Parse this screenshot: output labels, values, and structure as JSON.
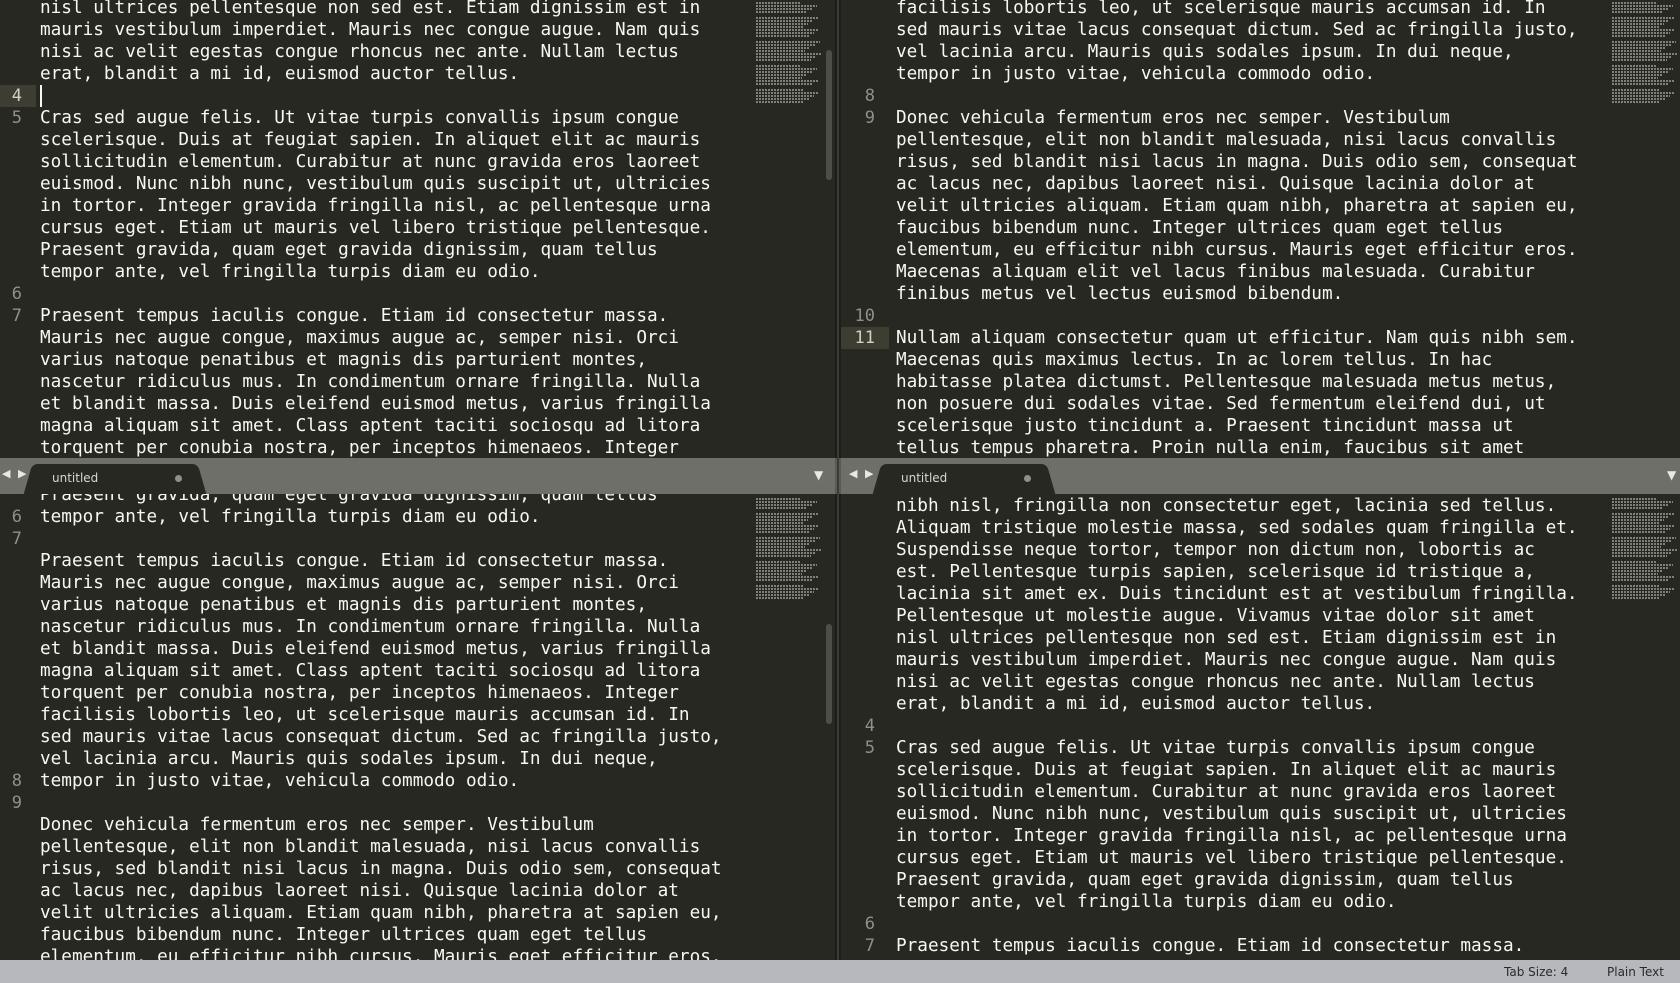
{
  "tabs": [
    {
      "label": "untitled"
    },
    {
      "label": "untitled"
    }
  ],
  "status": {
    "tab_size": "Tab Size: 4",
    "syntax": "Plain Text"
  },
  "panes": [
    {
      "id": "top-left",
      "gutter": [
        {
          "row": 4,
          "n": "4",
          "current": true
        },
        {
          "row": 5,
          "n": "5"
        },
        {
          "row": 13,
          "n": "6"
        },
        {
          "row": 14,
          "n": "7"
        }
      ],
      "lines": [
        "nisl ultrices pellentesque non sed est. Etiam dignissim est in",
        "mauris vestibulum imperdiet. Mauris nec congue augue. Nam quis",
        "nisi ac velit egestas congue rhoncus nec ante. Nullam lectus",
        "erat, blandit a mi id, euismod auctor tellus.",
        "",
        "Cras sed augue felis. Ut vitae turpis convallis ipsum congue",
        "scelerisque. Duis at feugiat sapien. In aliquet elit ac mauris",
        "sollicitudin elementum. Curabitur at nunc gravida eros laoreet",
        "euismod. Nunc nibh nunc, vestibulum quis suscipit ut, ultricies",
        "in tortor. Integer gravida fringilla nisl, ac pellentesque urna",
        "cursus eget. Etiam ut mauris vel libero tristique pellentesque.",
        "Praesent gravida, quam eget gravida dignissim, quam tellus",
        "tempor ante, vel fringilla turpis diam eu odio.",
        "",
        "Praesent tempus iaculis congue. Etiam id consectetur massa.",
        "Mauris nec augue congue, maximus augue ac, semper nisi. Orci",
        "varius natoque penatibus et magnis dis parturient montes,",
        "nascetur ridiculus mus. In condimentum ornare fringilla. Nulla",
        "et blandit massa. Duis eleifend euismod metus, varius fringilla",
        "magna aliquam sit amet. Class aptent taciti sociosqu ad litora",
        "torquent per conubia nostra, per inceptos himenaeos. Integer"
      ]
    },
    {
      "id": "top-right",
      "gutter": [
        {
          "row": 4,
          "n": "8"
        },
        {
          "row": 5,
          "n": "9"
        },
        {
          "row": 14,
          "n": "10"
        },
        {
          "row": 15,
          "n": "11",
          "current": true
        }
      ],
      "lines": [
        "facilisis lobortis leo, ut scelerisque mauris accumsan id. In",
        "sed mauris vitae lacus consequat dictum. Sed ac fringilla justo,",
        "vel lacinia arcu. Mauris quis sodales ipsum. In dui neque,",
        "tempor in justo vitae, vehicula commodo odio.",
        "",
        "Donec vehicula fermentum eros nec semper. Vestibulum",
        "pellentesque, elit non blandit malesuada, nisi lacus convallis",
        "risus, sed blandit nisi lacus in magna. Duis odio sem, consequat",
        "ac lacus nec, dapibus laoreet nisi. Quisque lacinia dolor at",
        "velit ultricies aliquam. Etiam quam nibh, pharetra at sapien eu,",
        "faucibus bibendum nunc. Integer ultrices quam eget tellus",
        "elementum, eu efficitur nibh cursus. Mauris eget efficitur eros.",
        "Maecenas aliquam elit vel lacus finibus malesuada. Curabitur",
        "finibus metus vel lectus euismod bibendum.",
        "",
        "Nullam aliquam consectetur quam ut efficitur. Nam quis nibh sem.",
        "Maecenas quis maximus lectus. In ac lorem tellus. In hac",
        "habitasse platea dictumst. Pellentesque malesuada metus metus,",
        "non posuere dui sodales vitae. Sed fermentum eleifend dui, ut",
        "scelerisque justo tincidunt a. Praesent tincidunt massa ut",
        "tellus tempus pharetra. Proin nulla enim, faucibus sit amet"
      ]
    },
    {
      "id": "bottom-left",
      "gutter": [
        {
          "row": 1,
          "n": "6"
        },
        {
          "row": 2,
          "n": "7"
        },
        {
          "row": 13,
          "n": "8"
        },
        {
          "row": 14,
          "n": "9"
        }
      ],
      "lines": [
        "Praesent gravida, quam eget gravida dignissim, quam tellus",
        "tempor ante, vel fringilla turpis diam eu odio.",
        "",
        "Praesent tempus iaculis congue. Etiam id consectetur massa.",
        "Mauris nec augue congue, maximus augue ac, semper nisi. Orci",
        "varius natoque penatibus et magnis dis parturient montes,",
        "nascetur ridiculus mus. In condimentum ornare fringilla. Nulla",
        "et blandit massa. Duis eleifend euismod metus, varius fringilla",
        "magna aliquam sit amet. Class aptent taciti sociosqu ad litora",
        "torquent per conubia nostra, per inceptos himenaeos. Integer",
        "facilisis lobortis leo, ut scelerisque mauris accumsan id. In",
        "sed mauris vitae lacus consequat dictum. Sed ac fringilla justo,",
        "vel lacinia arcu. Mauris quis sodales ipsum. In dui neque,",
        "tempor in justo vitae, vehicula commodo odio.",
        "",
        "Donec vehicula fermentum eros nec semper. Vestibulum",
        "pellentesque, elit non blandit malesuada, nisi lacus convallis",
        "risus, sed blandit nisi lacus in magna. Duis odio sem, consequat",
        "ac lacus nec, dapibus laoreet nisi. Quisque lacinia dolor at",
        "velit ultricies aliquam. Etiam quam nibh, pharetra at sapien eu,",
        "faucibus bibendum nunc. Integer ultrices quam eget tellus",
        "elementum, eu efficitur nibh cursus. Mauris eget efficitur eros."
      ]
    },
    {
      "id": "bottom-right",
      "gutter": [
        {
          "row": 10,
          "n": "4"
        },
        {
          "row": 11,
          "n": "5"
        },
        {
          "row": 19,
          "n": "6"
        },
        {
          "row": 20,
          "n": "7"
        }
      ],
      "lines": [
        "nibh nisl, fringilla non consectetur eget, lacinia sed tellus.",
        "Aliquam tristique molestie massa, sed sodales quam fringilla et.",
        "Suspendisse neque tortor, tempor non dictum non, lobortis ac",
        "est. Pellentesque turpis sapien, scelerisque id tristique a,",
        "lacinia sit amet ex. Duis tincidunt est at vestibulum fringilla.",
        "Pellentesque ut molestie augue. Vivamus vitae dolor sit amet",
        "nisl ultrices pellentesque non sed est. Etiam dignissim est in",
        "mauris vestibulum imperdiet. Mauris nec congue augue. Nam quis",
        "nisi ac velit egestas congue rhoncus nec ante. Nullam lectus",
        "erat, blandit a mi id, euismod auctor tellus.",
        "",
        "Cras sed augue felis. Ut vitae turpis convallis ipsum congue",
        "scelerisque. Duis at feugiat sapien. In aliquet elit ac mauris",
        "sollicitudin elementum. Curabitur at nunc gravida eros laoreet",
        "euismod. Nunc nibh nunc, vestibulum quis suscipit ut, ultricies",
        "in tortor. Integer gravida fringilla nisl, ac pellentesque urna",
        "cursus eget. Etiam ut mauris vel libero tristique pellentesque.",
        "Praesent gravida, quam eget gravida dignissim, quam tellus",
        "tempor ante, vel fringilla turpis diam eu odio.",
        "",
        "Praesent tempus iaculis congue. Etiam id consectetur massa."
      ]
    }
  ]
}
